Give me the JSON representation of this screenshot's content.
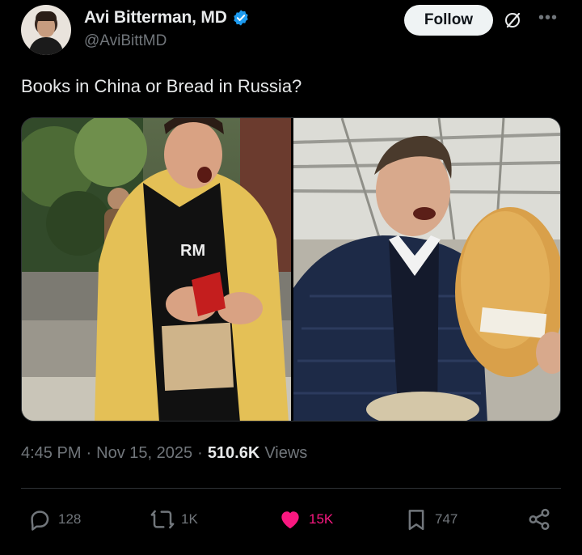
{
  "author": {
    "display_name": "Avi Bitterman, MD",
    "handle": "@AviBittMD",
    "verified": true
  },
  "header": {
    "follow_label": "Follow",
    "more_icon": "•••"
  },
  "tweet": {
    "text": "Books in China or Bread in Russia?"
  },
  "meta": {
    "time": "4:45 PM",
    "date": "Nov 15, 2025",
    "views_count": "510.6K",
    "views_label": "Views",
    "separator": "·"
  },
  "actions": {
    "replies": "128",
    "reposts": "1K",
    "likes": "15K",
    "bookmarks": "747"
  },
  "colors": {
    "background": "#000000",
    "text": "#e7e9ea",
    "muted": "#71767b",
    "verified": "#1d9bf0",
    "like": "#f91880"
  },
  "icons": [
    "verified-badge-icon",
    "grok-icon",
    "more-icon",
    "reply-icon",
    "repost-icon",
    "like-icon",
    "bookmark-icon",
    "share-icon"
  ]
}
